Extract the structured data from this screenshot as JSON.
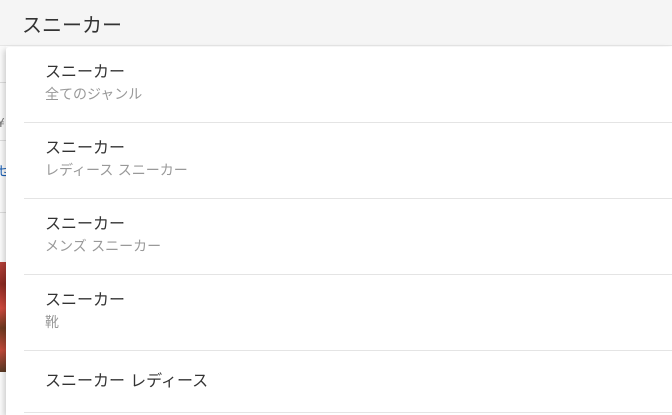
{
  "search": {
    "value": "スニーカー"
  },
  "suggestions": [
    {
      "label": "スニーカー",
      "genre": "全てのジャンル"
    },
    {
      "label": "スニーカー",
      "genre": "レディース スニーカー"
    },
    {
      "label": "スニーカー",
      "genre": "メンズ スニーカー"
    },
    {
      "label": "スニーカー",
      "genre": "靴"
    },
    {
      "label": "スニーカー レディース"
    }
  ],
  "background": {
    "left_link_glyph": "せ",
    "left_small_glyph": "¥"
  },
  "colors": {
    "search_bg": "#f5f5f5",
    "primary_text": "#333333",
    "secondary_text": "#999999",
    "divider": "#e4e4e4"
  }
}
